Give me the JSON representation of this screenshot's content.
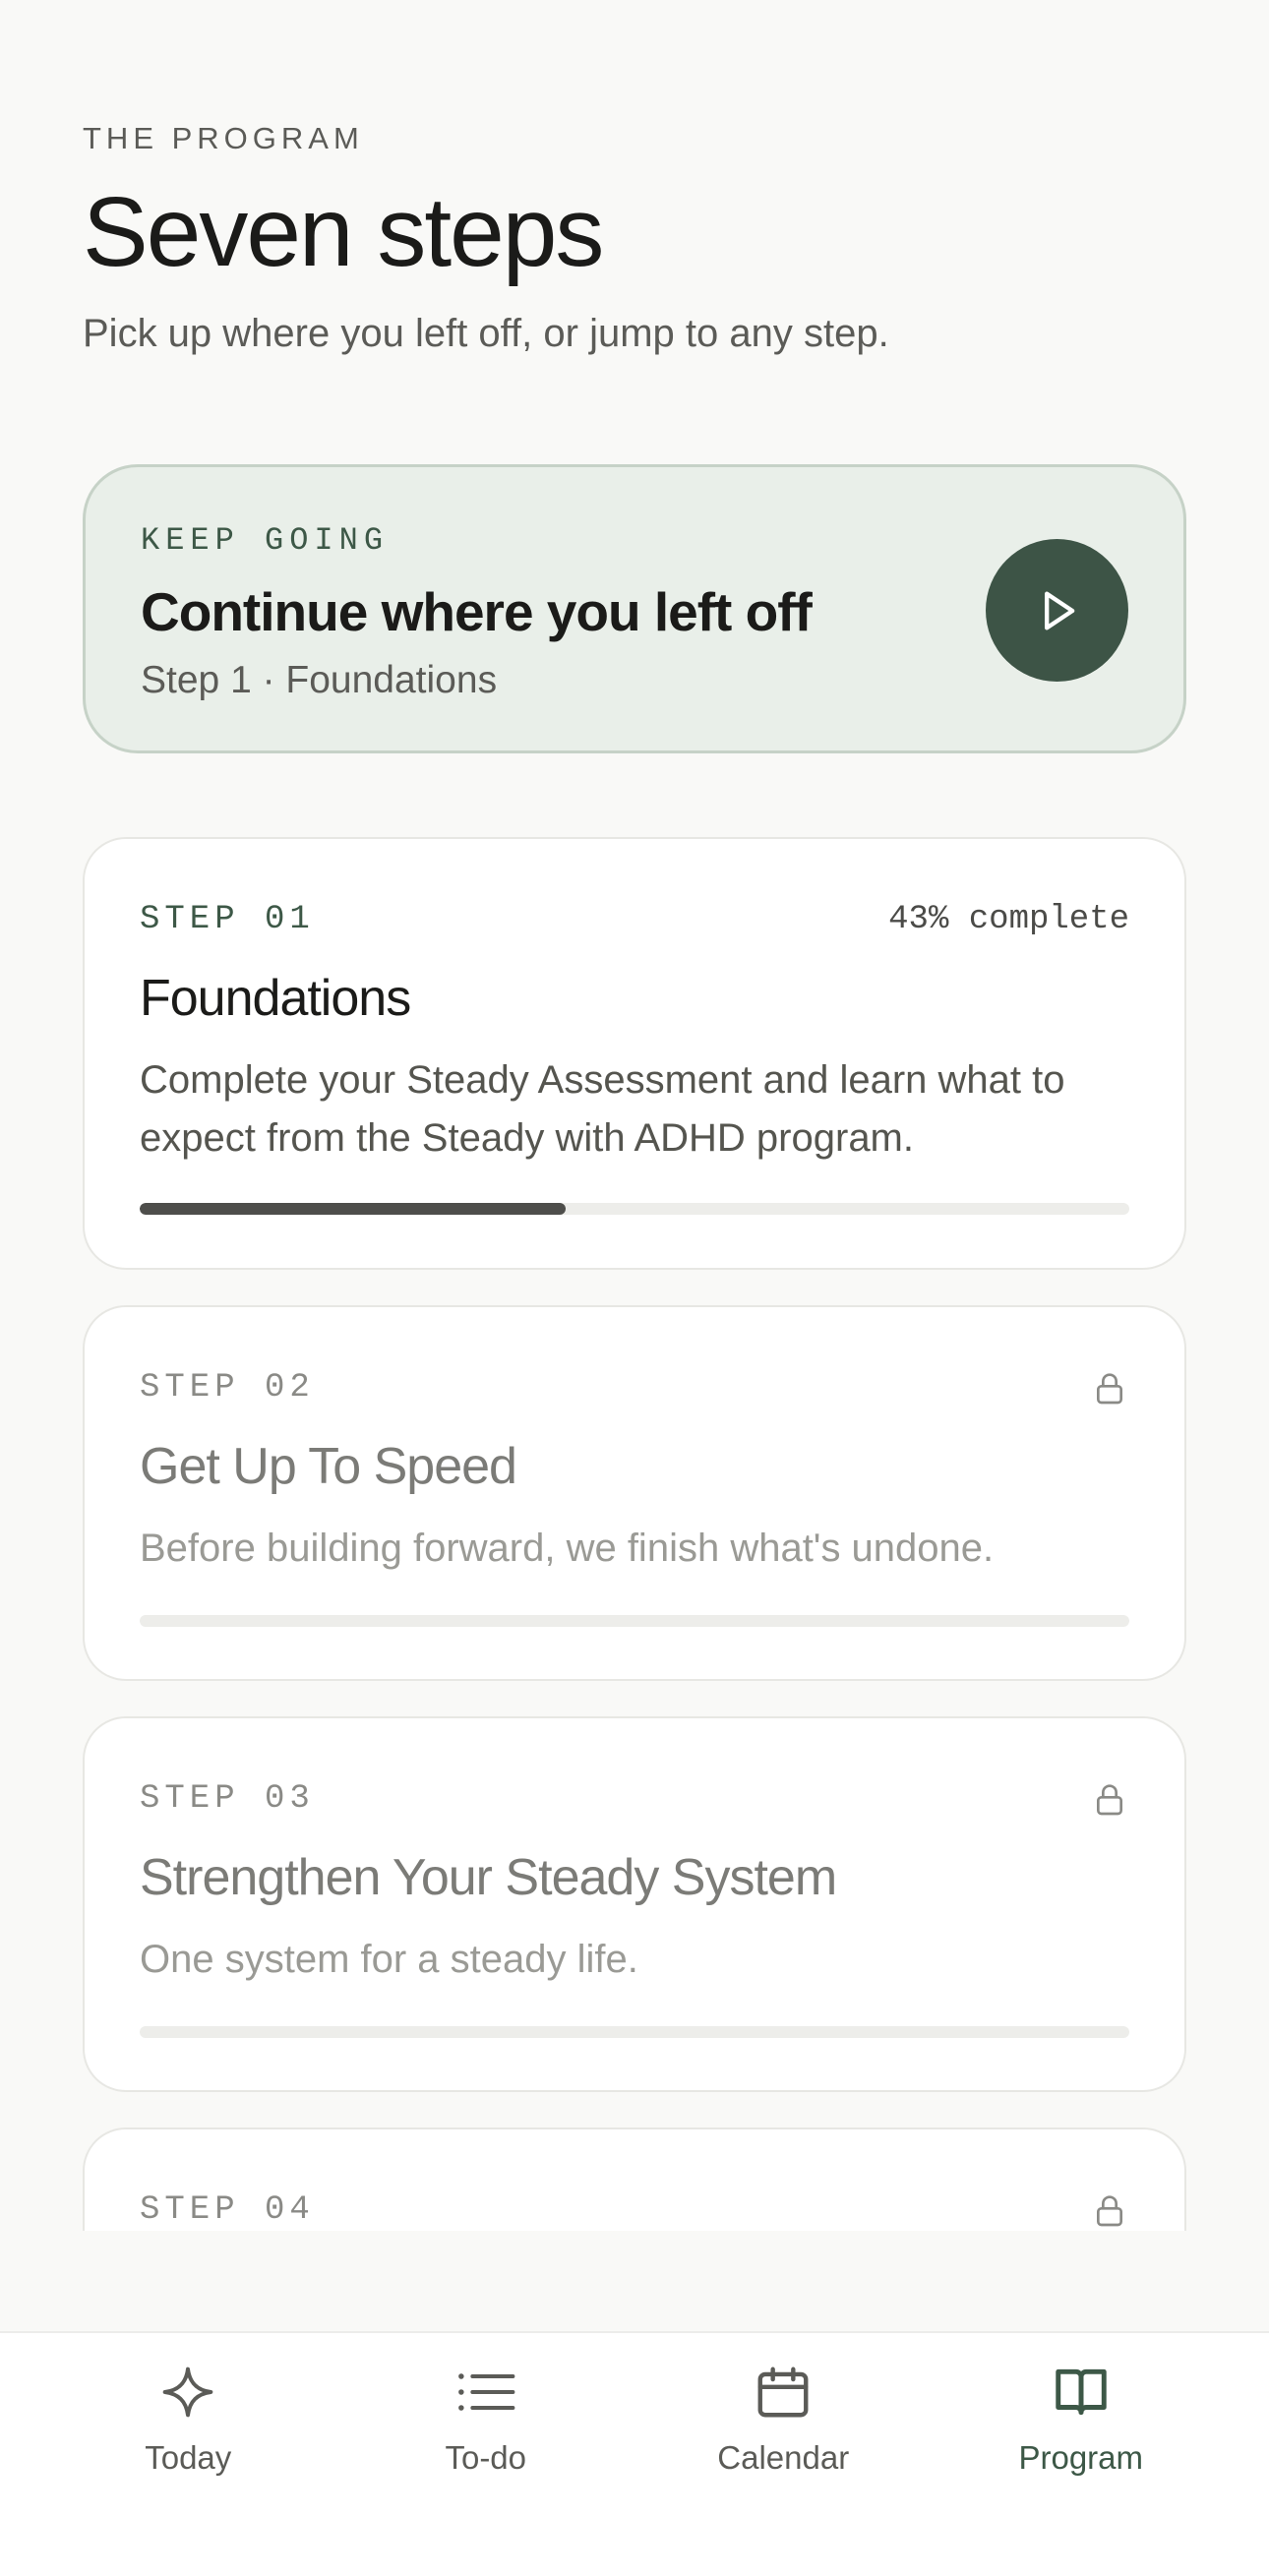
{
  "header": {
    "eyebrow": "THE PROGRAM",
    "title": "Seven steps",
    "subtitle": "Pick up where you left off, or jump to any step."
  },
  "continue": {
    "eyebrow": "KEEP GOING",
    "title": "Continue where you left off",
    "subtitle": "Step 1 · Foundations",
    "play_icon": "play-icon"
  },
  "steps": [
    {
      "label": "STEP 01",
      "title": "Foundations",
      "description": "Complete your Steady Assessment and learn what to expect from the Steady with ADHD program.",
      "status": "43% complete",
      "progress": 0.43,
      "locked": false
    },
    {
      "label": "STEP 02",
      "title": "Get Up To Speed",
      "description": "Before building forward, we finish what's undone.",
      "progress": 0,
      "locked": true
    },
    {
      "label": "STEP 03",
      "title": "Strengthen Your Steady System",
      "description": "One system for a steady life.",
      "progress": 0,
      "locked": true
    },
    {
      "label": "STEP 04",
      "locked": true
    }
  ],
  "tabs": [
    {
      "label": "Today",
      "icon": "sparkle-icon",
      "active": false
    },
    {
      "label": "To-do",
      "icon": "list-icon",
      "active": false
    },
    {
      "label": "Calendar",
      "icon": "calendar-icon",
      "active": false
    },
    {
      "label": "Program",
      "icon": "book-icon",
      "active": true
    }
  ],
  "colors": {
    "accent": "#3d5446",
    "background": "#f9f9f7",
    "continue_card": "#e9efe9"
  }
}
